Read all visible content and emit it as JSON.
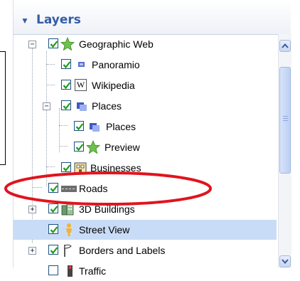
{
  "panel": {
    "title": "Layers",
    "header_chevron": "▼"
  },
  "layers": [
    {
      "label": "Geographic Web",
      "checked": true,
      "expander": "−",
      "icon": "green-star-icon"
    },
    {
      "label": "Panoramio",
      "checked": true,
      "icon": "panoramio-icon"
    },
    {
      "label": "Wikipedia",
      "checked": true,
      "icon": "wikipedia-icon",
      "icon_glyph": "W"
    },
    {
      "label": "Places",
      "checked": true,
      "expander": "−",
      "icon": "places-icon"
    },
    {
      "label": "Places",
      "checked": true,
      "icon": "places-icon"
    },
    {
      "label": "Preview",
      "checked": true,
      "icon": "green-star-icon"
    },
    {
      "label": "Businesses",
      "checked": true,
      "icon": "businesses-icon"
    },
    {
      "label": "Roads",
      "checked": true,
      "icon": "roads-icon"
    },
    {
      "label": "3D Buildings",
      "checked": true,
      "expander": "+",
      "icon": "buildings-icon"
    },
    {
      "label": "Street View",
      "checked": true,
      "icon": "street-view-icon",
      "selected": true
    },
    {
      "label": "Borders and Labels",
      "checked": true,
      "expander": "+",
      "icon": "borders-icon"
    },
    {
      "label": "Traffic",
      "checked": false,
      "icon": "traffic-icon"
    }
  ],
  "colors": {
    "accent": "#355ca8",
    "selected_row": "#c9dcf7",
    "annotation": "#e0141e",
    "checkmark": "#1d9a1d"
  }
}
